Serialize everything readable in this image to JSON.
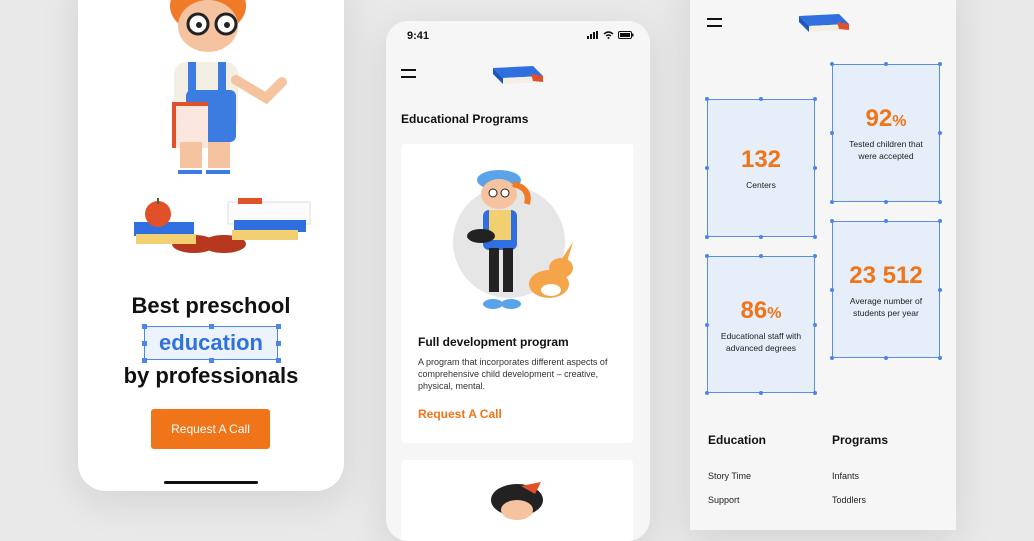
{
  "screen1": {
    "headline_line1": "Best preschool",
    "headline_highlight": "education",
    "headline_line3": "by professionals",
    "cta_label": "Request A Call"
  },
  "screen2": {
    "status_time": "9:41",
    "section_title": "Educational Programs",
    "card": {
      "title": "Full development program",
      "description": "A program that incorporates different aspects of comprehensive child development – creative, physical, mental.",
      "link_label": "Request A Call"
    }
  },
  "screen3": {
    "stats": [
      {
        "value": "132",
        "suffix": "",
        "label": "Centers"
      },
      {
        "value": "92",
        "suffix": "%",
        "label": "Tested children that were accepted"
      },
      {
        "value": "86",
        "suffix": "%",
        "label": "Educational staff with advanced degrees"
      },
      {
        "value": "23 512",
        "suffix": "",
        "label": "Average number of students per year"
      }
    ],
    "footer": {
      "education": {
        "title": "Education",
        "links": [
          "Story Time",
          "Support"
        ]
      },
      "programs": {
        "title": "Programs",
        "links": [
          "Infants",
          "Toddlers"
        ]
      }
    }
  },
  "colors": {
    "accent": "#f07418",
    "selection": "#4a87e8",
    "book_blue": "#2f6fe0",
    "book_red": "#e2502a"
  },
  "icons": [
    "hamburger-menu-icon",
    "book-logo-icon",
    "signal-icon",
    "wifi-icon",
    "battery-icon"
  ]
}
